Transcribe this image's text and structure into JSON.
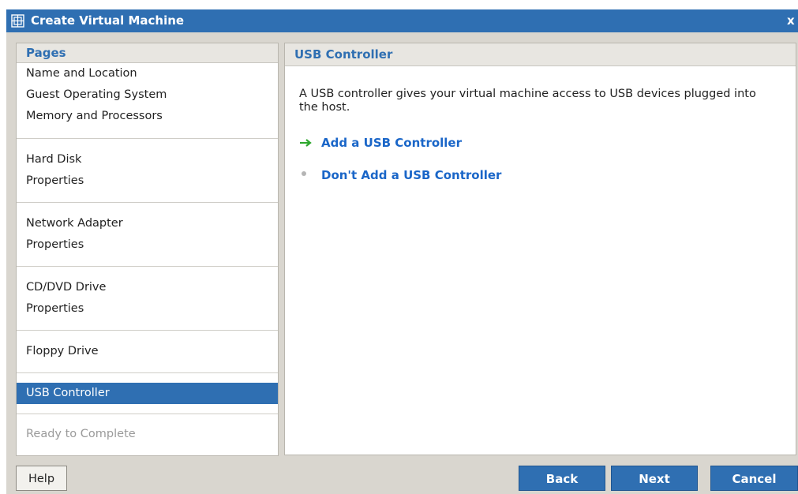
{
  "window": {
    "title": "Create Virtual Machine",
    "close_label": "x"
  },
  "pages_panel": {
    "header": "Pages",
    "groups": [
      {
        "items": [
          {
            "label": "Name and Location"
          },
          {
            "label": "Guest Operating System"
          },
          {
            "label": "Memory and Processors"
          }
        ]
      },
      {
        "items": [
          {
            "label": "Hard Disk"
          },
          {
            "label": "Properties"
          }
        ]
      },
      {
        "items": [
          {
            "label": "Network Adapter"
          },
          {
            "label": "Properties"
          }
        ]
      },
      {
        "items": [
          {
            "label": "CD/DVD Drive"
          },
          {
            "label": "Properties"
          }
        ]
      },
      {
        "items": [
          {
            "label": "Floppy Drive"
          }
        ]
      },
      {
        "items": [
          {
            "label": "USB Controller",
            "selected": true
          }
        ]
      },
      {
        "items": [
          {
            "label": "Ready to Complete",
            "disabled": true
          }
        ]
      }
    ]
  },
  "content": {
    "header": "USB Controller",
    "description": "A USB controller gives your virtual machine access to USB devices plugged into the host.",
    "options": [
      {
        "label": "Add a USB Controller",
        "marker": "arrow-icon",
        "marker_color": "#2ea82e"
      },
      {
        "label": "Don't Add a USB Controller",
        "marker": "dot-icon",
        "marker_color": "#b5b5b5"
      }
    ]
  },
  "buttons": {
    "help": "Help",
    "back": "Back",
    "next": "Next",
    "cancel": "Cancel"
  },
  "colors": {
    "accent": "#2f6fb2",
    "link": "#1a66c8",
    "panel_bg": "#d9d6cf"
  }
}
